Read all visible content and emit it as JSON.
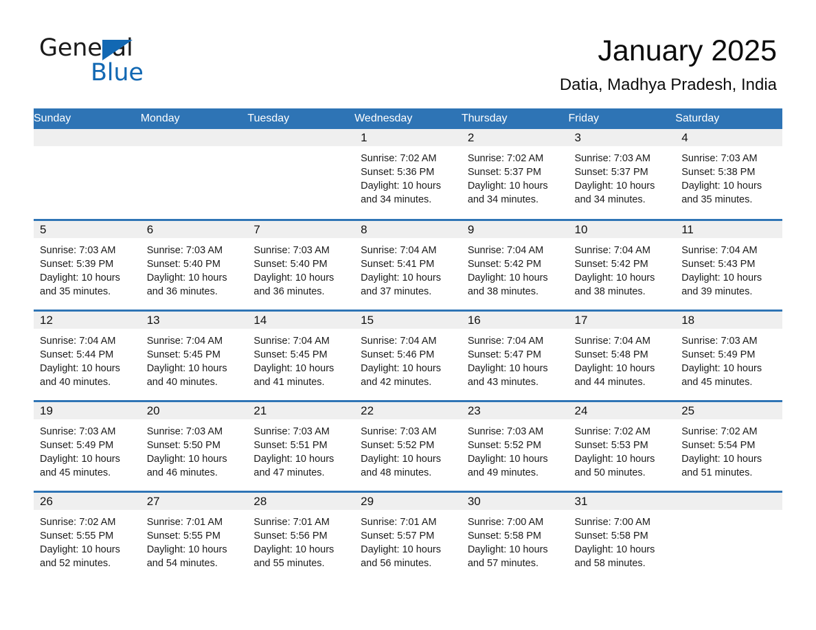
{
  "brand": {
    "line1": "General",
    "line2": "Blue",
    "accent_color": "#1268b3"
  },
  "header": {
    "month_title": "January 2025",
    "location": "Datia, Madhya Pradesh, India"
  },
  "theme": {
    "header_blue": "#2e74b5",
    "daynum_strip": "#efefef",
    "text": "#1a1a1a"
  },
  "weekday_headers": [
    "Sunday",
    "Monday",
    "Tuesday",
    "Wednesday",
    "Thursday",
    "Friday",
    "Saturday"
  ],
  "weeks": [
    [
      {
        "day": "",
        "lines": []
      },
      {
        "day": "",
        "lines": []
      },
      {
        "day": "",
        "lines": []
      },
      {
        "day": "1",
        "lines": [
          "Sunrise: 7:02 AM",
          "Sunset: 5:36 PM",
          "Daylight: 10 hours",
          "and 34 minutes."
        ]
      },
      {
        "day": "2",
        "lines": [
          "Sunrise: 7:02 AM",
          "Sunset: 5:37 PM",
          "Daylight: 10 hours",
          "and 34 minutes."
        ]
      },
      {
        "day": "3",
        "lines": [
          "Sunrise: 7:03 AM",
          "Sunset: 5:37 PM",
          "Daylight: 10 hours",
          "and 34 minutes."
        ]
      },
      {
        "day": "4",
        "lines": [
          "Sunrise: 7:03 AM",
          "Sunset: 5:38 PM",
          "Daylight: 10 hours",
          "and 35 minutes."
        ]
      }
    ],
    [
      {
        "day": "5",
        "lines": [
          "Sunrise: 7:03 AM",
          "Sunset: 5:39 PM",
          "Daylight: 10 hours",
          "and 35 minutes."
        ]
      },
      {
        "day": "6",
        "lines": [
          "Sunrise: 7:03 AM",
          "Sunset: 5:40 PM",
          "Daylight: 10 hours",
          "and 36 minutes."
        ]
      },
      {
        "day": "7",
        "lines": [
          "Sunrise: 7:03 AM",
          "Sunset: 5:40 PM",
          "Daylight: 10 hours",
          "and 36 minutes."
        ]
      },
      {
        "day": "8",
        "lines": [
          "Sunrise: 7:04 AM",
          "Sunset: 5:41 PM",
          "Daylight: 10 hours",
          "and 37 minutes."
        ]
      },
      {
        "day": "9",
        "lines": [
          "Sunrise: 7:04 AM",
          "Sunset: 5:42 PM",
          "Daylight: 10 hours",
          "and 38 minutes."
        ]
      },
      {
        "day": "10",
        "lines": [
          "Sunrise: 7:04 AM",
          "Sunset: 5:42 PM",
          "Daylight: 10 hours",
          "and 38 minutes."
        ]
      },
      {
        "day": "11",
        "lines": [
          "Sunrise: 7:04 AM",
          "Sunset: 5:43 PM",
          "Daylight: 10 hours",
          "and 39 minutes."
        ]
      }
    ],
    [
      {
        "day": "12",
        "lines": [
          "Sunrise: 7:04 AM",
          "Sunset: 5:44 PM",
          "Daylight: 10 hours",
          "and 40 minutes."
        ]
      },
      {
        "day": "13",
        "lines": [
          "Sunrise: 7:04 AM",
          "Sunset: 5:45 PM",
          "Daylight: 10 hours",
          "and 40 minutes."
        ]
      },
      {
        "day": "14",
        "lines": [
          "Sunrise: 7:04 AM",
          "Sunset: 5:45 PM",
          "Daylight: 10 hours",
          "and 41 minutes."
        ]
      },
      {
        "day": "15",
        "lines": [
          "Sunrise: 7:04 AM",
          "Sunset: 5:46 PM",
          "Daylight: 10 hours",
          "and 42 minutes."
        ]
      },
      {
        "day": "16",
        "lines": [
          "Sunrise: 7:04 AM",
          "Sunset: 5:47 PM",
          "Daylight: 10 hours",
          "and 43 minutes."
        ]
      },
      {
        "day": "17",
        "lines": [
          "Sunrise: 7:04 AM",
          "Sunset: 5:48 PM",
          "Daylight: 10 hours",
          "and 44 minutes."
        ]
      },
      {
        "day": "18",
        "lines": [
          "Sunrise: 7:03 AM",
          "Sunset: 5:49 PM",
          "Daylight: 10 hours",
          "and 45 minutes."
        ]
      }
    ],
    [
      {
        "day": "19",
        "lines": [
          "Sunrise: 7:03 AM",
          "Sunset: 5:49 PM",
          "Daylight: 10 hours",
          "and 45 minutes."
        ]
      },
      {
        "day": "20",
        "lines": [
          "Sunrise: 7:03 AM",
          "Sunset: 5:50 PM",
          "Daylight: 10 hours",
          "and 46 minutes."
        ]
      },
      {
        "day": "21",
        "lines": [
          "Sunrise: 7:03 AM",
          "Sunset: 5:51 PM",
          "Daylight: 10 hours",
          "and 47 minutes."
        ]
      },
      {
        "day": "22",
        "lines": [
          "Sunrise: 7:03 AM",
          "Sunset: 5:52 PM",
          "Daylight: 10 hours",
          "and 48 minutes."
        ]
      },
      {
        "day": "23",
        "lines": [
          "Sunrise: 7:03 AM",
          "Sunset: 5:52 PM",
          "Daylight: 10 hours",
          "and 49 minutes."
        ]
      },
      {
        "day": "24",
        "lines": [
          "Sunrise: 7:02 AM",
          "Sunset: 5:53 PM",
          "Daylight: 10 hours",
          "and 50 minutes."
        ]
      },
      {
        "day": "25",
        "lines": [
          "Sunrise: 7:02 AM",
          "Sunset: 5:54 PM",
          "Daylight: 10 hours",
          "and 51 minutes."
        ]
      }
    ],
    [
      {
        "day": "26",
        "lines": [
          "Sunrise: 7:02 AM",
          "Sunset: 5:55 PM",
          "Daylight: 10 hours",
          "and 52 minutes."
        ]
      },
      {
        "day": "27",
        "lines": [
          "Sunrise: 7:01 AM",
          "Sunset: 5:55 PM",
          "Daylight: 10 hours",
          "and 54 minutes."
        ]
      },
      {
        "day": "28",
        "lines": [
          "Sunrise: 7:01 AM",
          "Sunset: 5:56 PM",
          "Daylight: 10 hours",
          "and 55 minutes."
        ]
      },
      {
        "day": "29",
        "lines": [
          "Sunrise: 7:01 AM",
          "Sunset: 5:57 PM",
          "Daylight: 10 hours",
          "and 56 minutes."
        ]
      },
      {
        "day": "30",
        "lines": [
          "Sunrise: 7:00 AM",
          "Sunset: 5:58 PM",
          "Daylight: 10 hours",
          "and 57 minutes."
        ]
      },
      {
        "day": "31",
        "lines": [
          "Sunrise: 7:00 AM",
          "Sunset: 5:58 PM",
          "Daylight: 10 hours",
          "and 58 minutes."
        ]
      },
      {
        "day": "",
        "lines": []
      }
    ]
  ]
}
